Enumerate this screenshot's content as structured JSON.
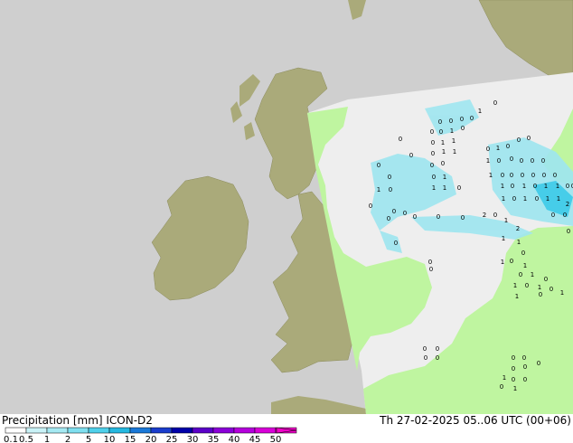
{
  "footer": {
    "title_left": "Precipitation [mm]  ICON-D2",
    "title_right": "Th 27-02-2025 05..06 UTC (00+06)"
  },
  "colors": {
    "sea": "#cfcfcf",
    "land_outside": "#aaaa7a",
    "domain_sea": "#eeeeee",
    "domain_land": "#bff5a0",
    "precip_light": "#9ee6f0",
    "precip_med": "#35c8e8"
  },
  "legend": {
    "thresholds": [
      "0.1",
      "0.5",
      "1",
      "2",
      "5",
      "10",
      "15",
      "20",
      "25",
      "30",
      "35",
      "40",
      "45",
      "50"
    ],
    "colors": [
      "#ffffff",
      "#c9f2f7",
      "#a5e9f2",
      "#7fdfef",
      "#4fd0ea",
      "#25b8e0",
      "#1a78d8",
      "#1a3ccc",
      "#0000a8",
      "#5a00c8",
      "#8a00d8",
      "#b400dc",
      "#d800d8",
      "#f000c8"
    ]
  },
  "map": {
    "value_labels": [
      "0",
      "1",
      "2"
    ]
  }
}
